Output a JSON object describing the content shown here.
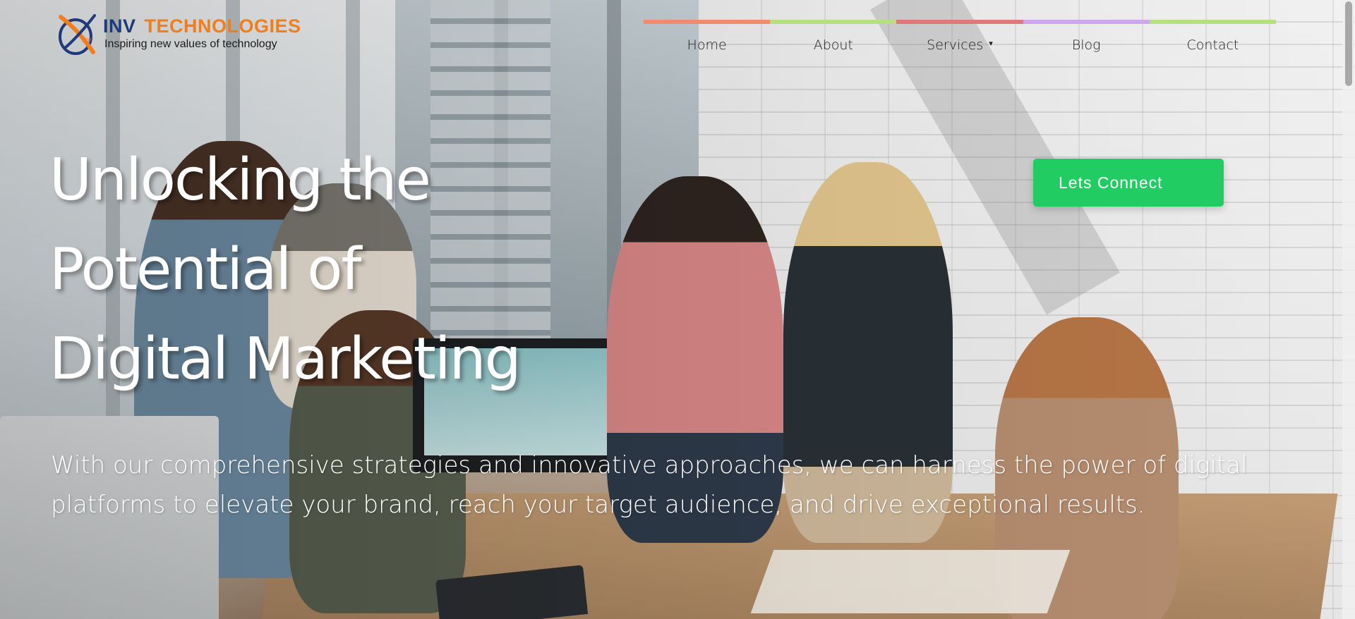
{
  "brand": {
    "name_part1": "INV",
    "name_part2": "TECHNOLOGIES",
    "tagline": "Inspiring new values of technology",
    "logo_mark_text": "INV",
    "colors": {
      "navy": "#1f3a7a",
      "orange": "#f07f1b"
    }
  },
  "nav": {
    "bar_colors": [
      "#f28a72",
      "#b6e07f",
      "#e07a7a",
      "#cfa7ec",
      "#b6e07f"
    ],
    "items": [
      {
        "label": "Home"
      },
      {
        "label": "About"
      },
      {
        "label": "Services",
        "caret": "▾"
      },
      {
        "label": "Blog"
      },
      {
        "label": "Contact"
      }
    ]
  },
  "hero": {
    "headline_lines": [
      "Unlocking the",
      "Potential of",
      "Digital Marketing"
    ],
    "subtext_lines": [
      "With our comprehensive strategies and innovative approaches, we can harness the power of digital",
      "platforms to elevate your brand, reach your target audience, and drive exceptional results."
    ],
    "cta_label": "Lets Connect",
    "cta_color": "#21cc62"
  }
}
